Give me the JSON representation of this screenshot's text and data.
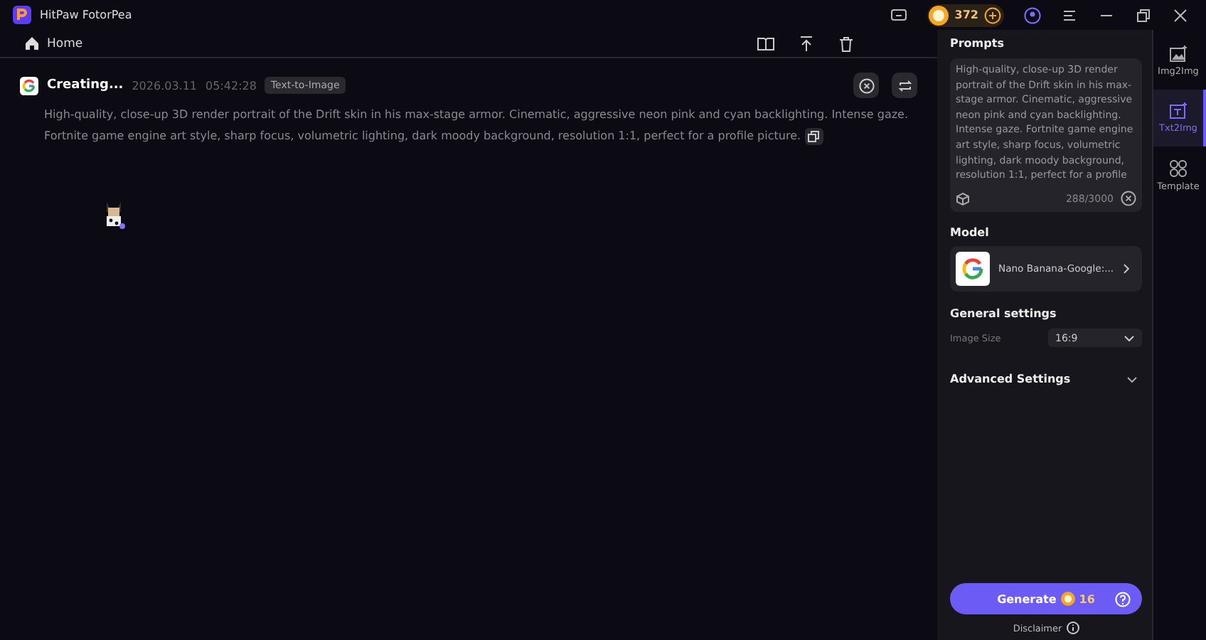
{
  "window": {
    "title": "HitPaw FotorPea"
  },
  "header": {
    "coins": "372"
  },
  "toolbar": {
    "home": "Home"
  },
  "task": {
    "status": "Creating...",
    "date": "2026.03.11",
    "time": "05:42:28",
    "tag": "Text-to-Image",
    "prompt": "High-quality, close-up 3D render portrait of the Drift skin in his max-stage armor. Cinematic, aggressive neon pink and cyan backlighting. Intense gaze. Fortnite game engine art style, sharp focus, volumetric lighting, dark moody background, resolution 1:1, perfect for a profile picture."
  },
  "panel": {
    "prompts_title": "Prompts",
    "prompt_value": "High-quality, close-up 3D render portrait of the Drift skin in his max-stage armor. Cinematic, aggressive neon pink and cyan backlighting. Intense gaze. Fortnite game engine art style, sharp focus, volumetric lighting, dark moody background, resolution 1:1, perfect for a profile",
    "counter": "288/3000",
    "model_title": "Model",
    "model_name": "Nano Banana-Google:...",
    "general_title": "General settings",
    "image_size_label": "Image Size",
    "image_size_value": "16:9",
    "advanced_title": "Advanced Settings",
    "generate": "Generate",
    "cost": "16",
    "disclaimer": "Disclaimer"
  },
  "tabs": [
    {
      "label": "Img2Img",
      "kind": "image",
      "selected": false
    },
    {
      "label": "Txt2Img",
      "kind": "text",
      "selected": true
    },
    {
      "label": "Template",
      "kind": "grid",
      "selected": false
    }
  ]
}
